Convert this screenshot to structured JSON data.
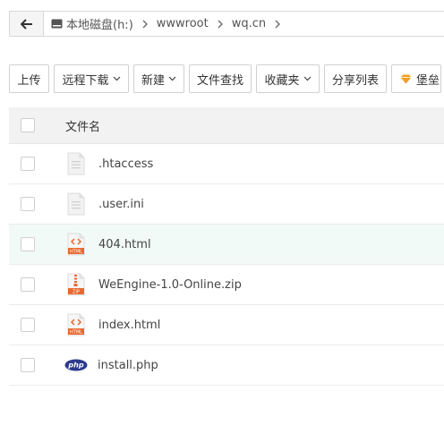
{
  "path": {
    "crumbs": [
      "本地磁盘(h:)",
      "wwwroot",
      "wq.cn"
    ]
  },
  "toolbar": {
    "upload": "上传",
    "remote_download": "远程下载",
    "new": "新建",
    "file_search": "文件查找",
    "favorites": "收藏夹",
    "share_list": "分享列表",
    "fortress": "堡垒"
  },
  "table": {
    "header": "文件名",
    "files": [
      {
        "name": ".htaccess",
        "icon": "text-file-icon"
      },
      {
        "name": ".user.ini",
        "icon": "text-file-icon"
      },
      {
        "name": "404.html",
        "icon": "html-file-icon"
      },
      {
        "name": "WeEngine-1.0-Online.zip",
        "icon": "zip-file-icon"
      },
      {
        "name": "index.html",
        "icon": "html-file-icon"
      },
      {
        "name": "install.php",
        "icon": "php-file-icon"
      }
    ]
  },
  "icon_labels": {
    "html": "HTML",
    "zip": "ZIP",
    "php": "php"
  },
  "colors": {
    "accent_orange": "#e8692f",
    "php_blue": "#2b3a8c",
    "hover_row": "#f2faf7",
    "gem": "#f0a020"
  }
}
